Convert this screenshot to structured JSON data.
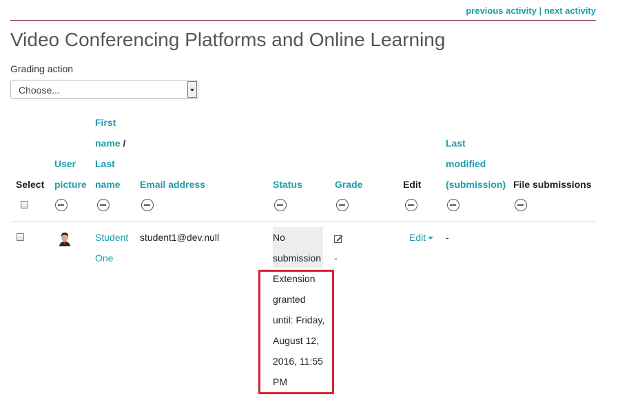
{
  "nav": {
    "previous_activity": "previous activity",
    "separator": "|",
    "next_activity": "next activity"
  },
  "page_title": "Video Conferencing Platforms and Online Learning",
  "grading_action": {
    "label": "Grading action",
    "selected": "Choose..."
  },
  "table": {
    "headers": {
      "select": "Select",
      "user_picture_1": "User",
      "user_picture_2": "picture",
      "first_name_1": "First",
      "first_name_2": "name",
      "name_slash": "/",
      "last_name_1": "Last",
      "last_name_2": "name",
      "email": "Email address",
      "status": "Status",
      "grade": "Grade",
      "edit": "Edit",
      "last_modified_1": "Last",
      "last_modified_2": "modified",
      "last_modified_3": "(submission)",
      "file_submissions": "File submissions"
    },
    "rows": [
      {
        "name_1": "Student",
        "name_2": "One",
        "email": "student1@dev.null",
        "status_1": "No",
        "status_2": "submission",
        "extension_lines": [
          "Extension",
          "granted",
          "until: Friday,",
          "August 12,",
          "2016, 11:55",
          "PM"
        ],
        "grade_value": "-",
        "edit_label": "Edit",
        "last_modified": "-"
      }
    ]
  },
  "colors": {
    "link": "#1a9fad",
    "rule": "#8b2442",
    "highlight": "#d6232e"
  }
}
